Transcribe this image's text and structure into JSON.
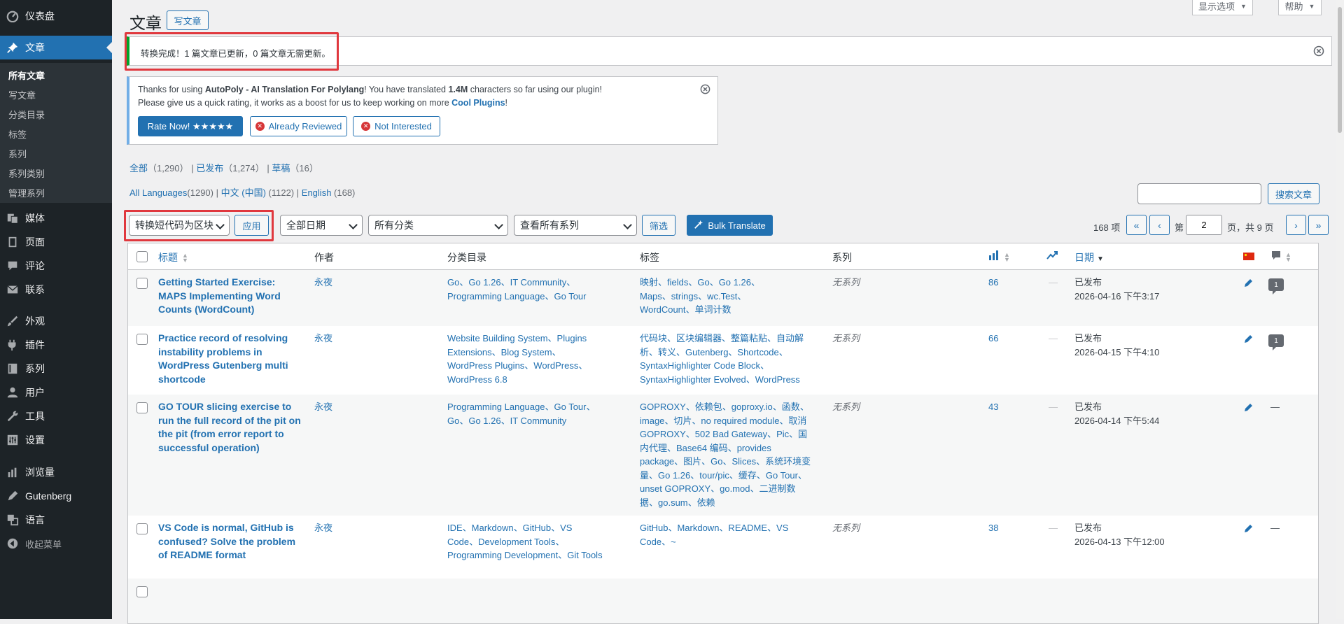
{
  "sidebar": {
    "items": [
      {
        "label": "仪表盘",
        "icon": "dashboard-icon"
      },
      {
        "label": "文章",
        "icon": "pin-icon",
        "active": true
      },
      {
        "label": "媒体",
        "icon": "media-icon"
      },
      {
        "label": "页面",
        "icon": "page-icon"
      },
      {
        "label": "评论",
        "icon": "comment-icon"
      },
      {
        "label": "联系",
        "icon": "mail-icon"
      },
      {
        "label": "外观",
        "icon": "brush-icon"
      },
      {
        "label": "插件",
        "icon": "plugin-icon"
      },
      {
        "label": "系列",
        "icon": "book-icon"
      },
      {
        "label": "用户",
        "icon": "user-icon"
      },
      {
        "label": "工具",
        "icon": "wrench-icon"
      },
      {
        "label": "设置",
        "icon": "settings-icon"
      },
      {
        "label": "浏览量",
        "icon": "bar-chart-icon"
      },
      {
        "label": "Gutenberg",
        "icon": "gutenberg-icon"
      },
      {
        "label": "语言",
        "icon": "translate-icon"
      },
      {
        "label": "收起菜单",
        "icon": "collapse-icon"
      }
    ],
    "submenu": [
      "所有文章",
      "写文章",
      "分类目录",
      "标签",
      "系列",
      "系列类别",
      "管理系列"
    ]
  },
  "header": {
    "title": "文章",
    "add_new": "写文章",
    "screen_options": "显示选项",
    "help": "帮助"
  },
  "notice": {
    "text": "转换完成！1 篇文章已更新，0 篇文章无需更新。"
  },
  "autopoly": {
    "line1_pre": "Thanks for using ",
    "plugin_name": "AutoPoly - AI Translation For Polylang",
    "line1_mid": "! You have translated ",
    "chars": "1.4M",
    "line1_post": " characters so far using our plugin!",
    "line2_pre": "Please give us a quick rating, it works as a boost for us to keep working on more ",
    "cool_plugins": "Cool Plugins",
    "line2_post": "!",
    "rate_now": "Rate Now! ★★★★★",
    "already_reviewed": "Already Reviewed",
    "not_interested": "Not Interested"
  },
  "views": {
    "all": "全部",
    "all_count": "（1,290）",
    "published": "已发布",
    "published_count": "（1,274）",
    "draft": "草稿",
    "draft_count": "（16）"
  },
  "languages": {
    "all": "All Languages",
    "all_count": "(1290)",
    "zh": "中文 (中国)",
    "zh_count": " (1122)",
    "en": "English",
    "en_count": " (168)"
  },
  "search": {
    "value": "",
    "button": "搜索文章"
  },
  "filters": {
    "bulk_action": "转换短代码为区块",
    "apply": "应用",
    "dates": "全部日期",
    "categories": "所有分类",
    "series": "查看所有系列",
    "filter": "筛选",
    "bulk_translate": "Bulk Translate"
  },
  "pagination": {
    "items": "168 项",
    "first": "«",
    "prev": "‹",
    "page_label": "第",
    "current": "2",
    "of": "页，共 9 页",
    "next": "›",
    "last": "»"
  },
  "columns": {
    "title": "标题",
    "author": "作者",
    "categories": "分类目录",
    "tags": "标签",
    "series": "系列",
    "date": "日期"
  },
  "rows": [
    {
      "title": "Getting Started Exercise: MAPS Implementing Word Counts (WordCount)",
      "author": "永夜",
      "categories": "Go、Go 1.26、IT Community、Programming Language、Go Tour",
      "tags": "映射、fields、Go、Go 1.26、Maps、strings、wc.Test、WordCount、单词计数",
      "series": "无系列",
      "views": "86",
      "dash": "—",
      "status": "已发布",
      "date": "2026-04-16 下午3:17",
      "comments": "1"
    },
    {
      "title": "Practice record of resolving instability problems in WordPress Gutenberg multi shortcode",
      "author": "永夜",
      "categories": "Website Building System、Plugins Extensions、Blog System、WordPress Plugins、WordPress、WordPress 6.8",
      "tags": "代码块、区块编辑器、整篇粘贴、自动解析、转义、Gutenberg、Shortcode、SyntaxHighlighter Code Block、SyntaxHighlighter Evolved、WordPress",
      "series": "无系列",
      "views": "66",
      "dash": "—",
      "status": "已发布",
      "date": "2026-04-15 下午4:10",
      "comments": "1"
    },
    {
      "title": "GO TOUR slicing exercise to run the full record of the pit on the pit (from error report to successful operation)",
      "author": "永夜",
      "categories": "Programming Language、Go Tour、Go、Go 1.26、IT Community",
      "tags": "GOPROXY、依赖包、goproxy.io、函数、image、切片、no required module、取消GOPROXY、502 Bad Gateway、Pic、国内代理、Base64 编码、provides package、图片、Go、Slices、系统环境变量、Go 1.26、tour/pic、缓存、Go Tour、unset GOPROXY、go.mod、二进制数据、go.sum、依赖",
      "series": "无系列",
      "views": "43",
      "dash": "—",
      "status": "已发布",
      "date": "2026-04-14 下午5:44",
      "comments": "—"
    },
    {
      "title": "VS Code is normal, GitHub is confused? Solve the problem of README format",
      "author": "永夜",
      "categories": "IDE、Markdown、GitHub、VS Code、Development Tools、Programming Development、Git Tools",
      "tags": "GitHub、Markdown、README、VS Code、~",
      "series": "无系列",
      "views": "38",
      "dash": "—",
      "status": "已发布",
      "date": "2026-04-13 下午12:00",
      "comments": "—"
    }
  ]
}
